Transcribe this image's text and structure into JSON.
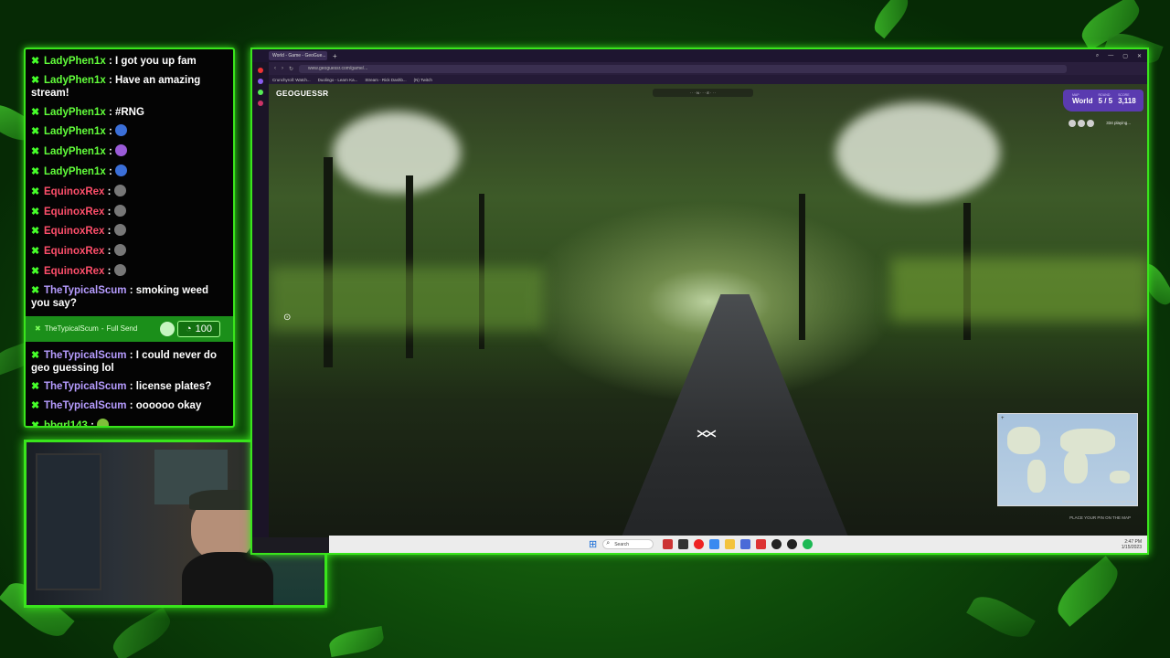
{
  "chat": {
    "messages": [
      {
        "user": "LadyPhen1x",
        "text": "I got you up fam",
        "color": "#62ff3b",
        "emote": ""
      },
      {
        "user": "LadyPhen1x",
        "text": "Have an amazing stream!",
        "color": "#62ff3b",
        "emote": ""
      },
      {
        "user": "LadyPhen1x",
        "text": "#RNG",
        "color": "#62ff3b",
        "emote": ""
      },
      {
        "user": "LadyPhen1x",
        "text": "",
        "color": "#62ff3b",
        "emote": "ghost-emote"
      },
      {
        "user": "LadyPhen1x",
        "text": "",
        "color": "#62ff3b",
        "emote": "dance-emote"
      },
      {
        "user": "LadyPhen1x",
        "text": "",
        "color": "#62ff3b",
        "emote": "ghost-emote"
      },
      {
        "user": "EquinoxRex",
        "text": "",
        "color": "#ff4f6b",
        "emote": "rock-emote"
      },
      {
        "user": "EquinoxRex",
        "text": "",
        "color": "#ff4f6b",
        "emote": "rock-emote"
      },
      {
        "user": "EquinoxRex",
        "text": "",
        "color": "#ff4f6b",
        "emote": "rock-emote"
      },
      {
        "user": "EquinoxRex",
        "text": "",
        "color": "#ff4f6b",
        "emote": "rock-emote"
      },
      {
        "user": "EquinoxRex",
        "text": "",
        "color": "#ff4f6b",
        "emote": "rock-emote"
      },
      {
        "user": "TheTypicalScum",
        "text": "smoking weed you say?",
        "color": "#b69cff",
        "emote": ""
      }
    ],
    "redeem": {
      "user": "TheTypicalScum",
      "reward": "Full Send",
      "points": "100"
    },
    "messages_after": [
      {
        "user": "TheTypicalScum",
        "text": "I could never do geo guessing lol",
        "color": "#b69cff",
        "emote": ""
      },
      {
        "user": "TheTypicalScum",
        "text": "license plates?",
        "color": "#b69cff",
        "emote": ""
      },
      {
        "user": "TheTypicalScum",
        "text": "oooooo okay",
        "color": "#b69cff",
        "emote": ""
      },
      {
        "user": "bbgrl143",
        "text": "",
        "color": "#62ff3b",
        "emote": "leaf-emote"
      }
    ]
  },
  "browser": {
    "tab_title": "World - Game - GeoGue...",
    "url": "www.geoguessr.com/game/...",
    "bookmarks": [
      "Crunchyroll: Watch...",
      "Duolingo - Learn Ka...",
      "Stream - Rick Dashb...",
      "(N) Twitch"
    ]
  },
  "game": {
    "logo": "GEOGUESSR",
    "map_label": "MAP",
    "map_name": "World",
    "round_label": "ROUND",
    "round": "5 / 5",
    "score_label": "SCORE",
    "score": "3,118",
    "players_playing": "334 playing...",
    "place_pin_hint": "PLACE YOUR PIN ON THE MAP",
    "map_attribution": "Keyboard shortcuts  Map data ©2023 Google  Terms"
  },
  "taskbar": {
    "search_placeholder": "Search",
    "time": "2:47 PM",
    "date": "1/15/2023"
  },
  "colors": {
    "accent": "#39e51c",
    "hud": "#5a3bb0",
    "chat_bg": "#040404"
  }
}
